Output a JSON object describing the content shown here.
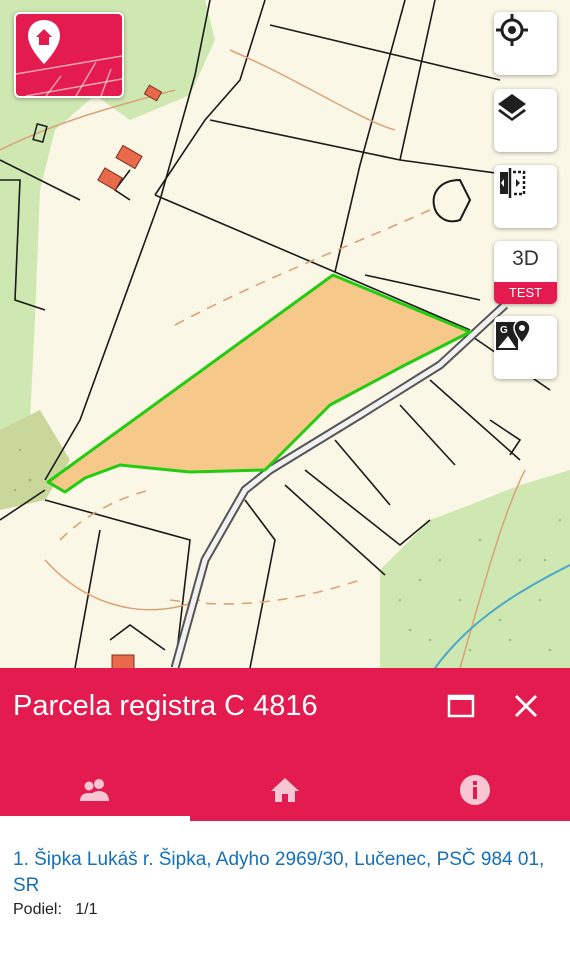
{
  "app": {
    "accent_color": "#e31b4e",
    "logo_icon": "map-pin-home-icon"
  },
  "map_controls": [
    {
      "name": "locate-button",
      "icon": "crosshair-icon"
    },
    {
      "name": "layers-button",
      "icon": "layers-icon"
    },
    {
      "name": "compare-button",
      "icon": "split-compare-icon"
    },
    {
      "name": "3d-button",
      "label": "3D",
      "badge": "TEST"
    },
    {
      "name": "google-maps-button",
      "icon": "google-maps-icon"
    }
  ],
  "map": {
    "selected_parcel_fill": "#f5c27e",
    "selected_parcel_outline": "#22cc11"
  },
  "panel": {
    "title": "Parcela registra C 4816",
    "maximize_icon": "maximize-icon",
    "close_icon": "close-icon",
    "tabs": [
      {
        "icon": "owners-icon",
        "active": true
      },
      {
        "icon": "home-icon",
        "active": false
      },
      {
        "icon": "info-icon",
        "active": false
      }
    ]
  },
  "owner": {
    "name_address": "1. Šipka Lukáš r. Šipka, Adyho 2969/30, Lučenec, PSČ 984 01, SR",
    "share_label": "Podiel:",
    "share_value": "1/1"
  }
}
